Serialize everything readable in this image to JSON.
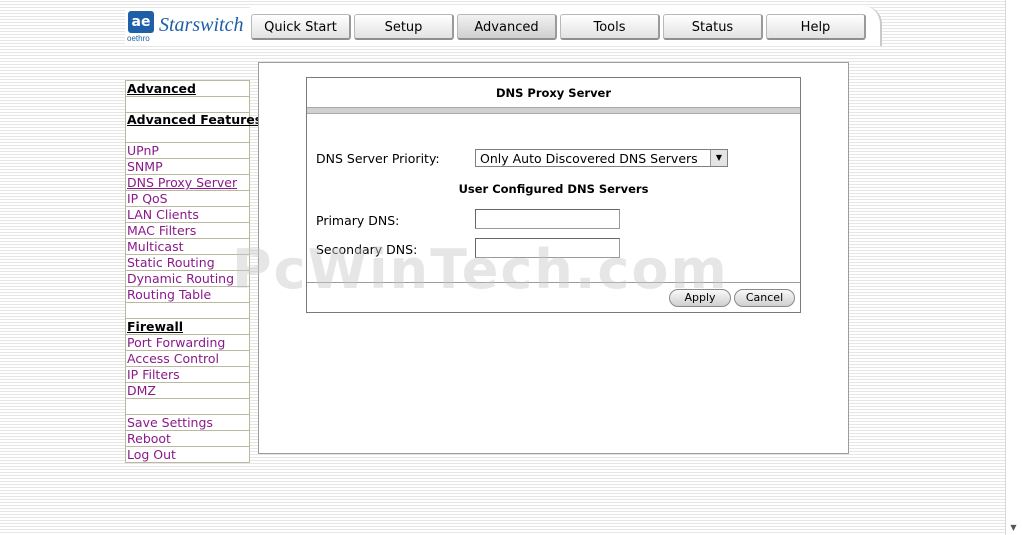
{
  "brand": {
    "mark": "ae",
    "sub": "oethro",
    "name": "Starswitch"
  },
  "tabs": [
    {
      "label": "Quick Start"
    },
    {
      "label": "Setup"
    },
    {
      "label": "Advanced"
    },
    {
      "label": "Tools"
    },
    {
      "label": "Status"
    },
    {
      "label": "Help"
    }
  ],
  "active_tab": "Advanced",
  "sidebar": {
    "advanced_heading": "Advanced",
    "features_heading": "Advanced Features",
    "features": [
      "UPnP",
      "SNMP",
      "DNS Proxy Server",
      "IP QoS",
      "LAN Clients",
      "MAC Filters",
      "Multicast",
      "Static Routing",
      "Dynamic Routing",
      "Routing Table"
    ],
    "firewall_heading": "Firewall",
    "firewall": [
      "Port Forwarding",
      "Access Control",
      "IP Filters",
      "DMZ"
    ],
    "actions": [
      "Save Settings",
      "Reboot",
      "Log Out"
    ]
  },
  "form": {
    "title": "DNS Proxy Server",
    "priority_label": "DNS Server Priority:",
    "priority_value": "Only Auto Discovered DNS Servers",
    "user_configured_title": "User Configured DNS Servers",
    "primary_label": "Primary DNS:",
    "primary_value": "",
    "secondary_label": "Secondary DNS:",
    "secondary_value": "",
    "apply_label": "Apply",
    "cancel_label": "Cancel"
  },
  "watermark": "PcWinTech.com"
}
